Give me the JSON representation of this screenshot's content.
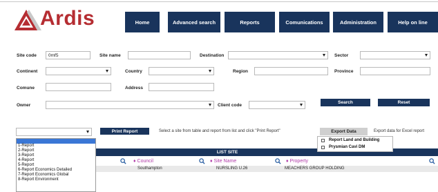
{
  "brand": {
    "name": "Ardis",
    "color": "#b52d32"
  },
  "nav": {
    "items": [
      "Home",
      "Advanced search",
      "Reports",
      "Comunications",
      "Administration",
      "Help on line"
    ],
    "color": "#19345c"
  },
  "filters": {
    "site_code": {
      "label": "Site code",
      "value": "0mf5"
    },
    "site_name": {
      "label": "Site name",
      "value": ""
    },
    "destination": {
      "label": "Destination",
      "value": ""
    },
    "sector": {
      "label": "Sector",
      "value": ""
    },
    "continent": {
      "label": "Continent",
      "value": ""
    },
    "country": {
      "label": "Country",
      "value": ""
    },
    "region": {
      "label": "Region",
      "value": ""
    },
    "province": {
      "label": "Province",
      "value": ""
    },
    "comune": {
      "label": "Comune",
      "value": ""
    },
    "address": {
      "label": "Address",
      "value": ""
    },
    "owner": {
      "label": "Owner",
      "value": ""
    },
    "client_code": {
      "label": "Client code",
      "value": ""
    }
  },
  "actions": {
    "search": "Search",
    "reset": "Reset"
  },
  "report": {
    "print_button": "Print Report",
    "hint": "Select a site from table and report from list and click \"Print Report\"",
    "options": [
      "1-Report",
      "2-Report",
      "3-Report",
      "4-Report",
      "5-Report",
      "6-Report Economics Detailed",
      "7-Report Economics Global",
      "8-Report Environment"
    ]
  },
  "export": {
    "button": "Export Data",
    "hint": "Export data for Excel report",
    "options": [
      "Report Land and Building",
      "Prysmian Cavi DM"
    ]
  },
  "list": {
    "title": "LIST SITE",
    "columns": [
      "Council",
      "Site Name",
      "Property"
    ],
    "sort_glyph": "♦",
    "rows": [
      {
        "partial": "n",
        "council": "Southampton",
        "site_name": "NURSLING U.26",
        "property": "MEACHERS GROUP HOLDING"
      }
    ]
  }
}
